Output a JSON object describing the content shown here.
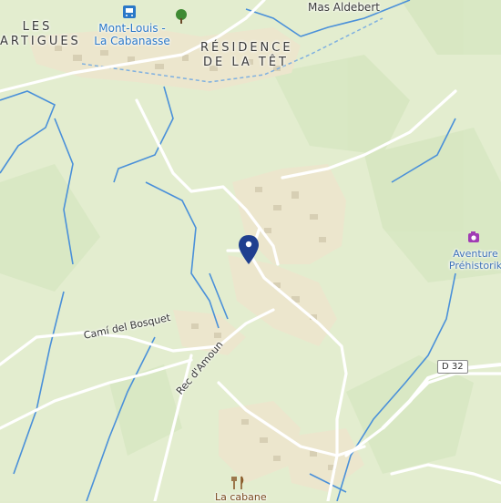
{
  "map": {
    "places": {
      "les_artigues": [
        "LES",
        "ARTIGUES"
      ],
      "residence": [
        "RÉSIDENCE",
        "DE LA TÊT"
      ],
      "mas_aldebert": "Mas Aldebert"
    },
    "station": {
      "line1": "Mont-Louis -",
      "line2": "La Cabanasse",
      "icon": "train-icon"
    },
    "poi": {
      "line1": "Aventure",
      "line2": "Préhistorik",
      "icon": "camera-icon"
    },
    "roads": {
      "cami": "Camí del Bosquet",
      "rec": "Rec d'Amoun",
      "d32": "D 32"
    },
    "restaurant": {
      "label": "La cabane",
      "icon": "cutlery-icon"
    },
    "marker": {
      "icon": "map-pin-icon"
    },
    "tree": {
      "icon": "tree-icon"
    },
    "colors": {
      "land": "#e2eccd",
      "built": "#efe8d0",
      "water": "#4a90d9",
      "road": "#ffffff",
      "pin": "#1f3f8f"
    }
  }
}
